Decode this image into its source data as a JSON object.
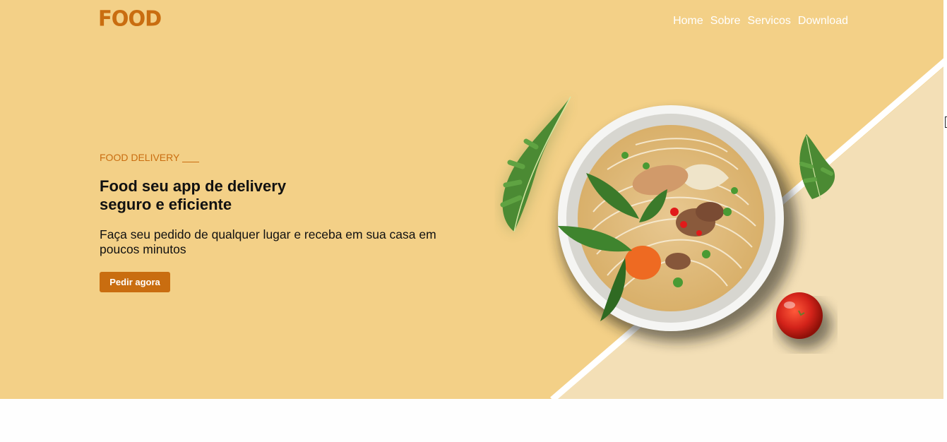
{
  "brand": {
    "logo": "FOOD",
    "color": "#c96d10",
    "background": "#f3d087"
  },
  "nav": {
    "items": [
      {
        "label": "Home"
      },
      {
        "label": "Sobre"
      },
      {
        "label": "Servicos"
      },
      {
        "label": "Download"
      }
    ]
  },
  "hero": {
    "eyebrow": "FOOD DELIVERY",
    "headline_line1": "Food seu app de delivery",
    "headline_line2": "seguro e eficiente",
    "subtext": "Faça seu pedido de qualquer lugar e receba em sua casa em poucos minutos",
    "cta_label": "Pedir agora"
  },
  "images": {
    "bowl": "noodle-soup-bowl-image",
    "leaf_left": "arugula-leaf-image",
    "leaf_right": "arugula-leaf-image",
    "tomato": "cherry-tomato-image"
  }
}
